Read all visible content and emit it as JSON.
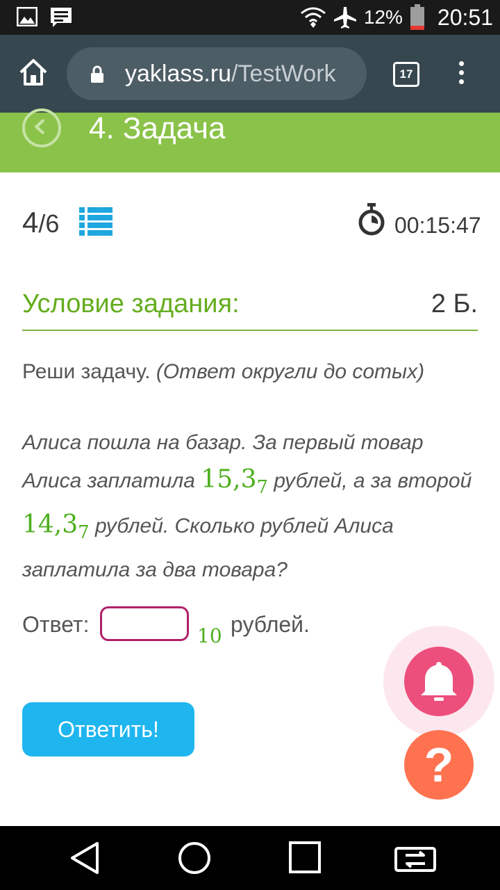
{
  "status_bar": {
    "battery": "12%",
    "time": "20:51"
  },
  "browser": {
    "url_host": "yaklass.ru",
    "url_path": "/TestWork",
    "tab_count": "17"
  },
  "header": {
    "title": "4. Задача"
  },
  "task": {
    "progress_current": "4",
    "progress_total": "/6",
    "timer": "00:15:47",
    "condition_title": "Условие задания:",
    "points": "2 Б.",
    "instruction": "Реши задачу.",
    "instruction_note": "(Ответ округли до сотых)",
    "problem": {
      "part1": "Алиса пошла на базар. За первый товар Алиса заплатила ",
      "num1": "15,3",
      "base1": "7",
      "part2": " рублей, а за второй ",
      "num2": "14,3",
      "base2": "7",
      "part3": " рублей. Сколько рублей Алиса заплатила за два товара?"
    },
    "answer_label": "Ответ:",
    "answer_value": "",
    "answer_base": "10",
    "answer_unit": "рублей.",
    "submit_label": "Ответить!"
  },
  "fab": {
    "help_label": "?"
  },
  "colors": {
    "accent_green": "#8bc34a",
    "submit_blue": "#1fb6f0",
    "bell_pink": "#ec4f7c",
    "help_orange": "#ff7250"
  }
}
